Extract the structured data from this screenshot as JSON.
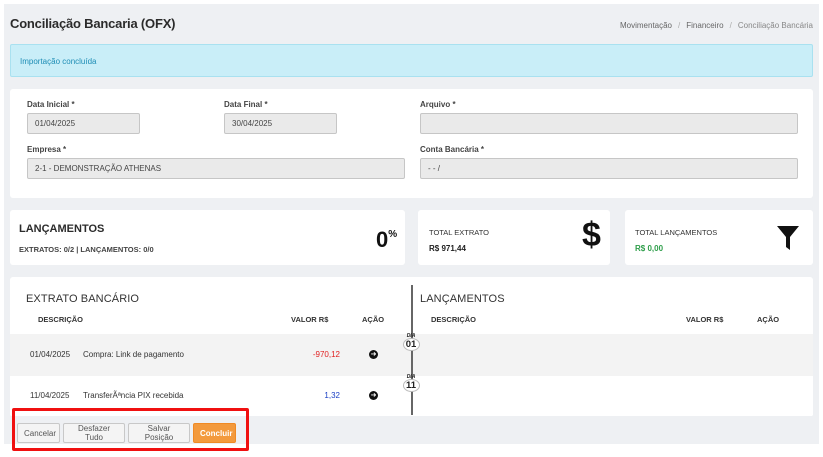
{
  "page": {
    "title": "Conciliação Bancaria (OFX)",
    "breadcrumbs": [
      "Movimentação",
      "Financeiro",
      "Conciliação Bancária"
    ]
  },
  "alert": {
    "message": "Importação concluída"
  },
  "form": {
    "data_inicial": {
      "label": "Data Inicial *",
      "value": "01/04/2025"
    },
    "data_final": {
      "label": "Data Final *",
      "value": "30/04/2025"
    },
    "arquivo": {
      "label": "Arquivo *",
      "value": ""
    },
    "empresa": {
      "label": "Empresa *",
      "value": "2-1 - DEMONSTRAÇÃO ATHENAS"
    },
    "conta_bancaria": {
      "label": "Conta Bancária *",
      "value": "- - /"
    }
  },
  "summary": {
    "lancamentos": {
      "title": "LANÇAMENTOS",
      "subtitle": "EXTRATOS: 0/2 | LANÇAMENTOS: 0/0",
      "percent": "0",
      "percent_sign": "%"
    },
    "total_extrato": {
      "label": "TOTAL EXTRATO",
      "value": "R$ 971,44",
      "icon": "dollar-icon"
    },
    "total_lancamentos": {
      "label": "TOTAL LANÇAMENTOS",
      "value": "R$ 0,00",
      "icon": "filter-icon",
      "value_color": "#2e9e4a"
    }
  },
  "extrato": {
    "title": "EXTRATO BANCÁRIO",
    "columns": {
      "descricao": "DESCRIÇÃO",
      "valor": "VALOR R$",
      "acao": "AÇÃO"
    },
    "rows": [
      {
        "date": "01/04/2025",
        "desc": "Compra: Link de pagamento",
        "valor": "-970,12",
        "color": "#e02020",
        "day_label": "DIA",
        "day": "01"
      },
      {
        "date": "11/04/2025",
        "desc": "TransferÃªncia PIX recebida",
        "valor": "1,32",
        "color": "#1a3fc4",
        "day_label": "DIA",
        "day": "11"
      }
    ]
  },
  "lancamentos_panel": {
    "title": "LANÇAMENTOS",
    "columns": {
      "descricao": "DESCRIÇÃO",
      "valor": "VALOR R$",
      "acao": "AÇÃO"
    }
  },
  "actions": {
    "cancelar": "Cancelar",
    "desfazer": "Desfazer Tudo",
    "salvar": "Salvar Posição",
    "concluir": "Concluir"
  }
}
